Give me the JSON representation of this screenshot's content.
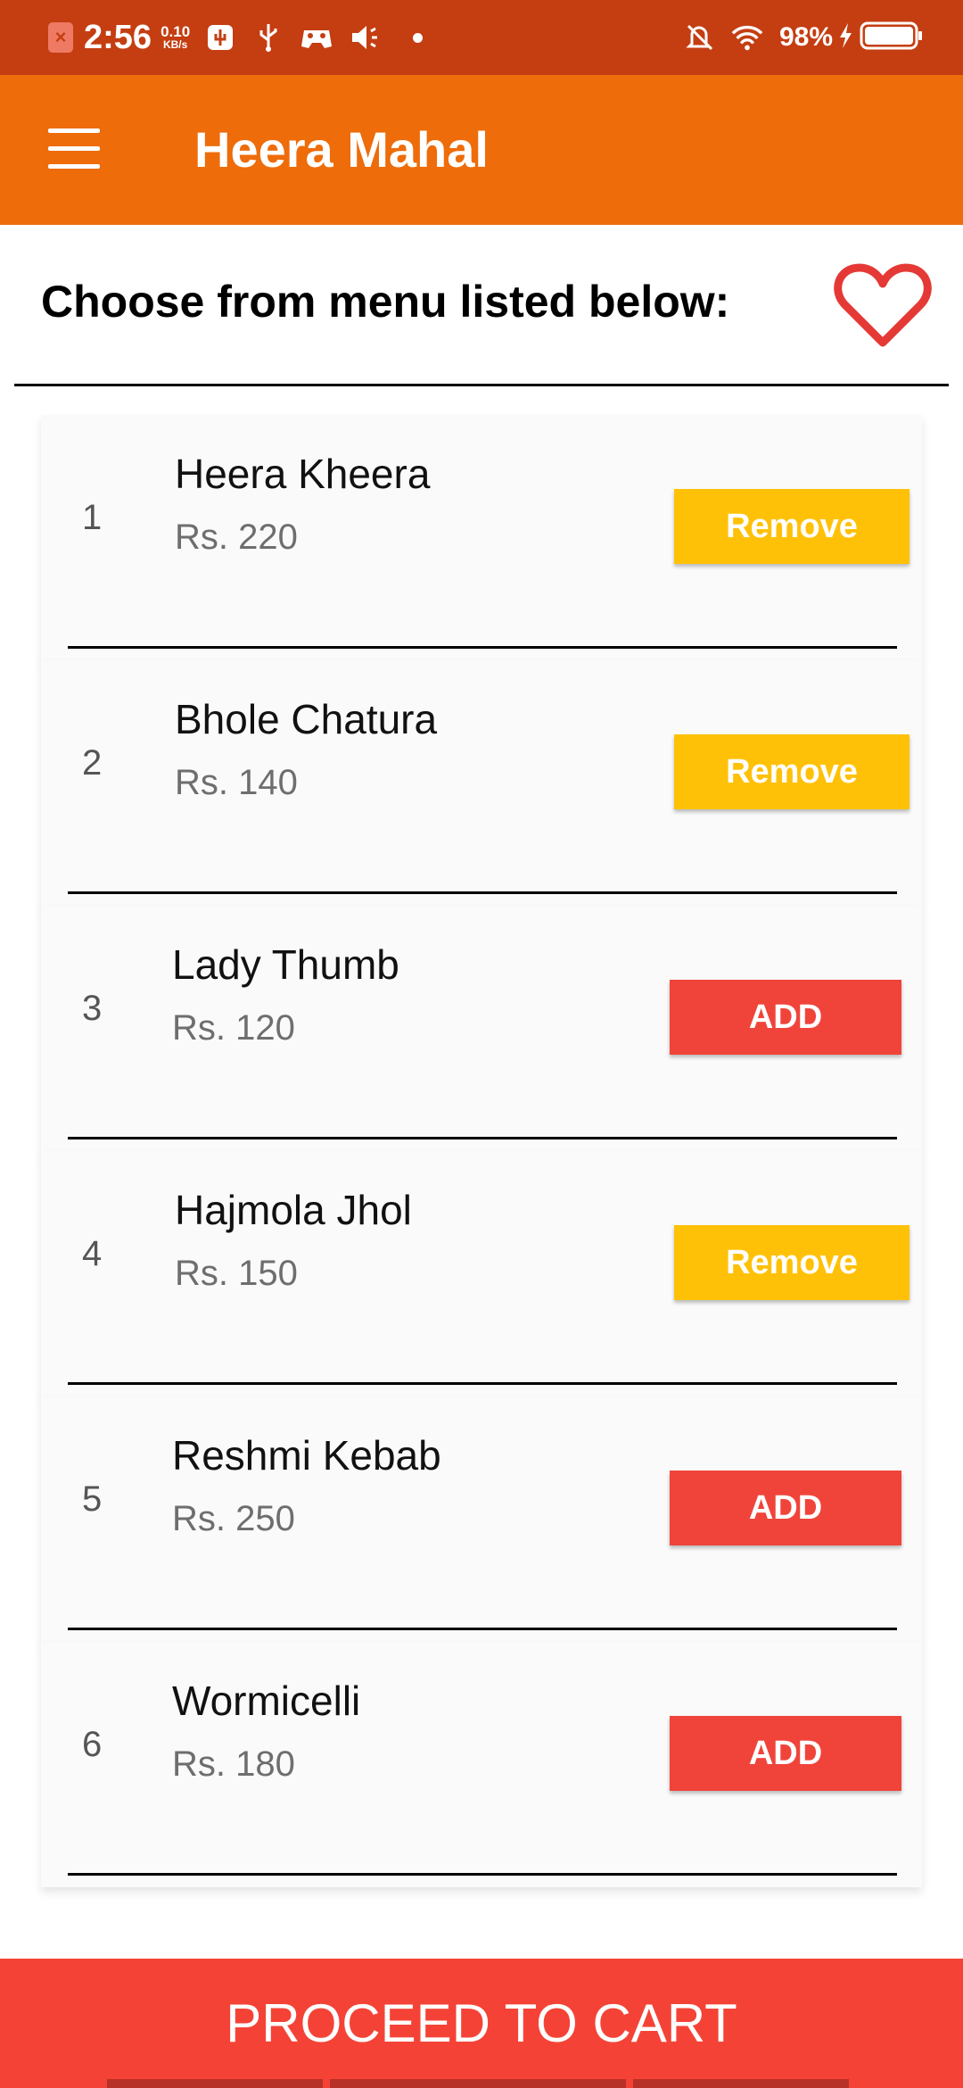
{
  "status_bar": {
    "time": "2:56",
    "net_speed": "0.10",
    "net_unit": "KB/s",
    "battery": "98%"
  },
  "app_bar": {
    "title": "Heera Mahal",
    "menu_icon": "hamburger-menu-icon"
  },
  "header": {
    "heading": "Choose from menu listed below:",
    "favorite_icon": "heart-outline-icon",
    "favorite_color": "#e53935"
  },
  "menu_items": [
    {
      "num": "1",
      "name": "Heera Kheera",
      "price": "Rs. 220",
      "action": "Remove"
    },
    {
      "num": "2",
      "name": "Bhole Chatura",
      "price": "Rs. 140",
      "action": "Remove"
    },
    {
      "num": "3",
      "name": "Lady Thumb",
      "price": "Rs. 120",
      "action": "ADD"
    },
    {
      "num": "4",
      "name": "Hajmola Jhol",
      "price": "Rs. 150",
      "action": "Remove"
    },
    {
      "num": "5",
      "name": "Reshmi Kebab",
      "price": "Rs. 250",
      "action": "ADD"
    },
    {
      "num": "6",
      "name": "Wormicelli",
      "price": "Rs. 180",
      "action": "ADD"
    }
  ],
  "colors": {
    "status_bar": "#c43e12",
    "app_bar": "#ee6c0a",
    "remove_button": "#ffc107",
    "add_button": "#f0443a",
    "cta": "#f44336"
  },
  "cta": {
    "label": "PROCEED TO CART"
  }
}
